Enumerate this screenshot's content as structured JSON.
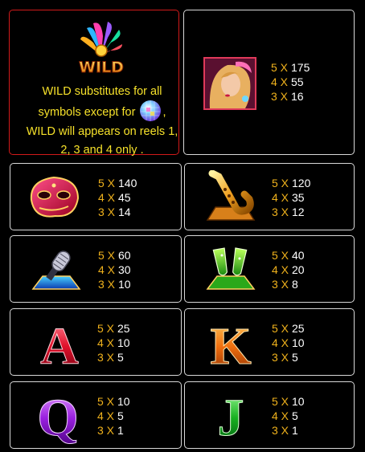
{
  "wild": {
    "logo_text": "WILD",
    "line1": "WILD substitutes for all",
    "line2_before": "symbols except for",
    "line2_after": ",",
    "line3": "WILD will appears on reels 1,",
    "line4": "2, 3 and 4 only ."
  },
  "symbols": [
    {
      "name": "woman",
      "icon": "woman-portrait-icon",
      "pays": [
        {
          "k": "5 X",
          "v": "175"
        },
        {
          "k": "4 X",
          "v": "55"
        },
        {
          "k": "3 X",
          "v": "16"
        }
      ]
    },
    {
      "name": "mask",
      "icon": "carnival-mask-icon",
      "pays": [
        {
          "k": "5 X",
          "v": "140"
        },
        {
          "k": "4 X",
          "v": "45"
        },
        {
          "k": "3 X",
          "v": "14"
        }
      ]
    },
    {
      "name": "saxophone",
      "icon": "saxophone-icon",
      "pays": [
        {
          "k": "5 X",
          "v": "120"
        },
        {
          "k": "4 X",
          "v": "35"
        },
        {
          "k": "3 X",
          "v": "12"
        }
      ]
    },
    {
      "name": "microphone",
      "icon": "microphone-icon",
      "pays": [
        {
          "k": "5 X",
          "v": "60"
        },
        {
          "k": "4 X",
          "v": "30"
        },
        {
          "k": "3 X",
          "v": "10"
        }
      ]
    },
    {
      "name": "champagne",
      "icon": "champagne-glasses-icon",
      "pays": [
        {
          "k": "5 X",
          "v": "40"
        },
        {
          "k": "4 X",
          "v": "20"
        },
        {
          "k": "3 X",
          "v": "8"
        }
      ]
    },
    {
      "name": "A",
      "icon": "letter-a-icon",
      "letter": "A",
      "pays": [
        {
          "k": "5 X",
          "v": "25"
        },
        {
          "k": "4 X",
          "v": "10"
        },
        {
          "k": "3 X",
          "v": "5"
        }
      ]
    },
    {
      "name": "K",
      "icon": "letter-k-icon",
      "letter": "K",
      "pays": [
        {
          "k": "5 X",
          "v": "25"
        },
        {
          "k": "4 X",
          "v": "10"
        },
        {
          "k": "3 X",
          "v": "5"
        }
      ]
    },
    {
      "name": "Q",
      "icon": "letter-q-icon",
      "letter": "Q",
      "pays": [
        {
          "k": "5 X",
          "v": "10"
        },
        {
          "k": "4 X",
          "v": "5"
        },
        {
          "k": "3 X",
          "v": "1"
        }
      ]
    },
    {
      "name": "J",
      "icon": "letter-j-icon",
      "letter": "J",
      "pays": [
        {
          "k": "5 X",
          "v": "10"
        },
        {
          "k": "4 X",
          "v": "5"
        },
        {
          "k": "3 X",
          "v": "1"
        }
      ]
    }
  ],
  "colors": {
    "payout_key": "#f0b21c",
    "payout_value": "#ffffff",
    "wild_text": "#f6e12a",
    "wild_border": "#d21a1a",
    "panel_border": "#d8d8d8"
  }
}
